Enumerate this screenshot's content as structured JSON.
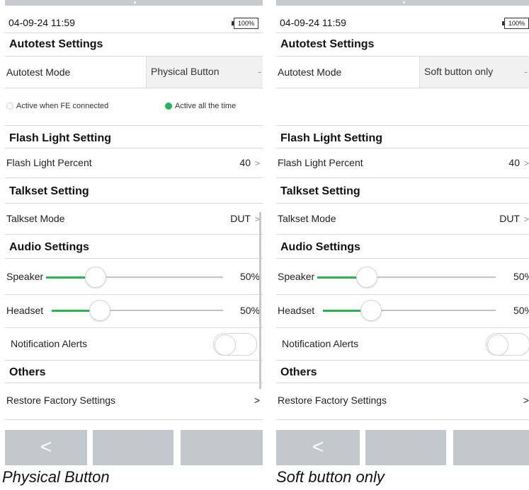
{
  "screens": [
    {
      "status": {
        "datetime": "04-09-24 11:59",
        "battery": "100%"
      },
      "autotest": {
        "title": "Autotest Settings",
        "mode_label": "Autotest Mode",
        "mode_value": "Physical Button",
        "mode_dash": "-",
        "radio_options": [
          "Active when FE connected",
          "Active all the time"
        ],
        "radio_selected": "Active all the time"
      },
      "flash": {
        "title": "Flash Light Setting",
        "percent_label": "Flash Light Percent",
        "percent_value": "40"
      },
      "talkset": {
        "title": "Talkset Setting",
        "mode_label": "Talkset Mode",
        "mode_value": "DUT"
      },
      "audio": {
        "title": "Audio Settings",
        "speaker_label": "Speaker",
        "speaker_value": "50%",
        "speaker_level": 0.5,
        "headset_label": "Headset",
        "headset_value": "50%",
        "headset_level": 0.5
      },
      "notifications": {
        "label": "Notification Alerts",
        "enabled": false
      },
      "others": {
        "title": "Others",
        "restore_label": "Restore Factory Settings"
      },
      "caption": "Physical Button"
    },
    {
      "status": {
        "datetime": "04-09-24 11:59",
        "battery": "100%"
      },
      "autotest": {
        "title": "Autotest Settings",
        "mode_label": "Autotest Mode",
        "mode_value": "Soft button only",
        "mode_dash": "-"
      },
      "flash": {
        "title": "Flash Light Setting",
        "percent_label": "Flash Light Percent",
        "percent_value": "40"
      },
      "talkset": {
        "title": "Talkset Setting",
        "mode_label": "Talkset Mode",
        "mode_value": "DUT"
      },
      "audio": {
        "title": "Audio Settings",
        "speaker_label": "Speaker",
        "speaker_value": "50%",
        "speaker_level": 0.5,
        "headset_label": "Headset",
        "headset_value": "50%",
        "headset_level": 0.5
      },
      "notifications": {
        "label": "Notification Alerts",
        "enabled": false
      },
      "others": {
        "title": "Others",
        "restore_label": "Restore Factory Settings"
      },
      "caption": "Soft button only"
    }
  ],
  "icons": {
    "chevron": "chevron-right-icon",
    "back": "back-arrow-icon"
  },
  "glyphs": {
    "chevron": ">",
    "back": "<"
  },
  "colors": {
    "accent_green": "#2bb34d",
    "nav_button": "#c3c8cd",
    "mode_box": "#f1f1f1"
  }
}
